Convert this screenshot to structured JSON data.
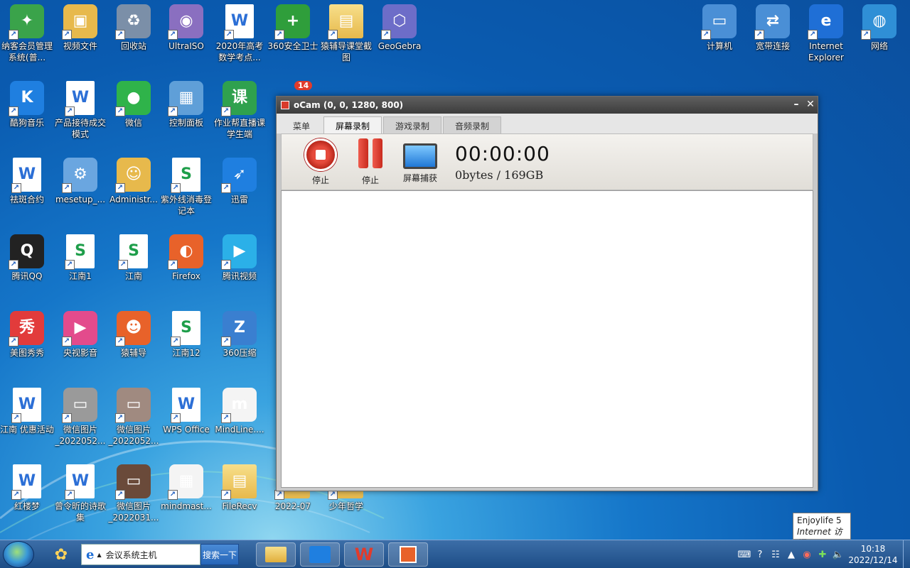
{
  "desktop": {
    "icons": [
      {
        "label": "纳客会员管理系统(普...",
        "glyph": "✦",
        "color": "#3aa34a"
      },
      {
        "label": "视频文件",
        "glyph": "▣",
        "color": "#e7b94c"
      },
      {
        "label": "回收站",
        "glyph": "♻",
        "color": "#7b8fa8"
      },
      {
        "label": "UltraISO",
        "glyph": "◉",
        "color": "#8a6fc0"
      },
      {
        "label": "2020年高考数学考点...",
        "glyph": "W",
        "color": "#2c6fd6"
      },
      {
        "label": "360安全卫士",
        "glyph": "+",
        "color": "#2f9e3b"
      },
      {
        "label": "猿辅导课堂截图",
        "glyph": "▤",
        "color": "#e7b94c"
      },
      {
        "label": "GeoGebra",
        "glyph": "⬡",
        "color": "#6d6dc8"
      },
      {
        "label": "酷狗音乐",
        "glyph": "K",
        "color": "#1f7fe0"
      },
      {
        "label": "产品接待成交模式",
        "glyph": "W",
        "color": "#2c6fd6"
      },
      {
        "label": "微信",
        "glyph": "●",
        "color": "#2fb34a"
      },
      {
        "label": "控制面板",
        "glyph": "▦",
        "color": "#5f9fd8"
      },
      {
        "label": "作业帮直播课学生端",
        "glyph": "课",
        "color": "#2fa14e"
      },
      {
        "label": "祛斑合约",
        "glyph": "W",
        "color": "#2c6fd6"
      },
      {
        "label": "mesetup_...",
        "glyph": "⚙",
        "color": "#6aa6e0"
      },
      {
        "label": "Administr...",
        "glyph": "☺",
        "color": "#e7b94c"
      },
      {
        "label": "紫外线消毒登记本",
        "glyph": "S",
        "color": "#1e9e4a"
      },
      {
        "label": "迅雷",
        "glyph": "➶",
        "color": "#1f7fe0"
      },
      {
        "label": "腾讯QQ",
        "glyph": "Q",
        "color": "#222222"
      },
      {
        "label": "江南1",
        "glyph": "S",
        "color": "#1e9e4a"
      },
      {
        "label": "江南",
        "glyph": "S",
        "color": "#1e9e4a"
      },
      {
        "label": "Firefox",
        "glyph": "◐",
        "color": "#e8622a"
      },
      {
        "label": "腾讯视频",
        "glyph": "▶",
        "color": "#2bb0e8"
      },
      {
        "label": "美图秀秀",
        "glyph": "秀",
        "color": "#e23b3b"
      },
      {
        "label": "央视影音",
        "glyph": "▶",
        "color": "#e34b8c"
      },
      {
        "label": "猿辅导",
        "glyph": "☻",
        "color": "#e8622a"
      },
      {
        "label": "江南12",
        "glyph": "S",
        "color": "#1e9e4a"
      },
      {
        "label": "360压缩",
        "glyph": "Z",
        "color": "#3a7fd0"
      },
      {
        "label": "江南 优惠活动",
        "glyph": "W",
        "color": "#2c6fd6"
      },
      {
        "label": "微信图片_2022052...",
        "glyph": "▭",
        "color": "#9a9a9a"
      },
      {
        "label": "微信图片_2022052...",
        "glyph": "▭",
        "color": "#a08a80"
      },
      {
        "label": "WPS Office",
        "glyph": "W",
        "color": "#e23b2b"
      },
      {
        "label": "MindLine....",
        "glyph": "m",
        "color": "#f4f4f4"
      },
      {
        "label": "红楼梦",
        "glyph": "W",
        "color": "#2c6fd6"
      },
      {
        "label": "曾令昕的诗歌集",
        "glyph": "W",
        "color": "#2c6fd6"
      },
      {
        "label": "微信图片_2022031...",
        "glyph": "▭",
        "color": "#6a4a3a"
      },
      {
        "label": "mindmast...",
        "glyph": "▦",
        "color": "#f4f4f4"
      },
      {
        "label": "FileRecv",
        "glyph": "▤",
        "color": "#e7b94c"
      },
      {
        "label": "2022-07",
        "glyph": "▤",
        "color": "#e7b94c"
      },
      {
        "label": "少年哲学",
        "glyph": "▤",
        "color": "#2a3a6a"
      },
      {
        "label": "计算机",
        "glyph": "▭",
        "color": "#4a8fd6"
      },
      {
        "label": "宽带连接",
        "glyph": "⇄",
        "color": "#4a8fd6"
      },
      {
        "label": "Internet Explorer",
        "glyph": "e",
        "color": "#1f6fd6"
      },
      {
        "label": "网络",
        "glyph": "◍",
        "color": "#2f8fd6"
      }
    ]
  },
  "ocam": {
    "title": "oCam (0, 0, 1280, 800)",
    "tabs": [
      "菜单",
      "屏幕录制",
      "游戏录制",
      "音频录制"
    ],
    "active_tab": "屏幕录制",
    "buttons": {
      "stop": "停止",
      "pause": "停止",
      "capture": "屏幕捕获"
    },
    "timer": "00:00:00",
    "size": "0bytes / 169GB"
  },
  "tooltip": {
    "line1": "Enjoylife  5",
    "line2": "Internet 访问"
  },
  "taskbar": {
    "address_text": "会议系统主机",
    "search_label": "搜索一下",
    "time": "10:18",
    "date": "2022/12/14",
    "badge": "14"
  }
}
